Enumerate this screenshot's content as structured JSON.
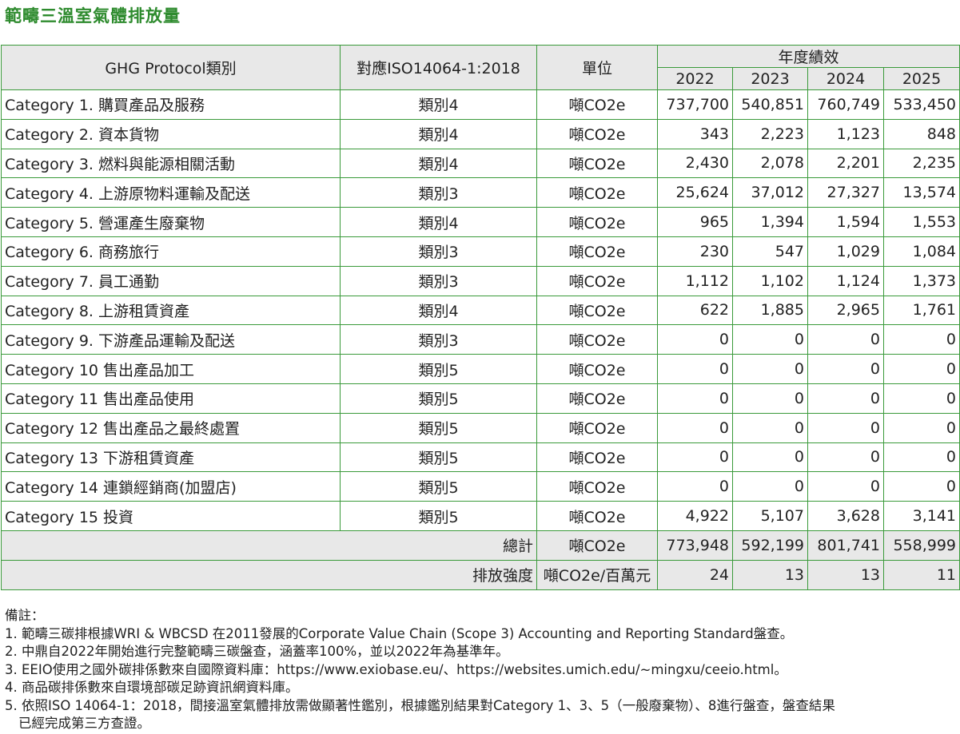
{
  "title": "範疇三溫室氣體排放量",
  "header": {
    "col_category": "GHG Protocol類別",
    "col_iso": "對應ISO14064-1:2018",
    "col_unit": "單位",
    "col_perf": "年度績效",
    "years": [
      "2022",
      "2023",
      "2024",
      "2025"
    ]
  },
  "rows": [
    {
      "category": "Category 1. 購買產品及服務",
      "iso": "類別4",
      "unit": "噸CO2e",
      "v": [
        "737,700",
        "540,851",
        "760,749",
        "533,450"
      ]
    },
    {
      "category": "Category 2. 資本貨物",
      "iso": "類別4",
      "unit": "噸CO2e",
      "v": [
        "343",
        "2,223",
        "1,123",
        "848"
      ]
    },
    {
      "category": "Category 3. 燃料與能源相關活動",
      "iso": "類別4",
      "unit": "噸CO2e",
      "v": [
        "2,430",
        "2,078",
        "2,201",
        "2,235"
      ]
    },
    {
      "category": "Category 4. 上游原物料運輸及配送",
      "iso": "類別3",
      "unit": "噸CO2e",
      "v": [
        "25,624",
        "37,012",
        "27,327",
        "13,574"
      ]
    },
    {
      "category": "Category 5. 營運產生廢棄物",
      "iso": "類別4",
      "unit": "噸CO2e",
      "v": [
        "965",
        "1,394",
        "1,594",
        "1,553"
      ]
    },
    {
      "category": "Category 6. 商務旅行",
      "iso": "類別3",
      "unit": "噸CO2e",
      "v": [
        "230",
        "547",
        "1,029",
        "1,084"
      ]
    },
    {
      "category": "Category 7. 員工通勤",
      "iso": "類別3",
      "unit": "噸CO2e",
      "v": [
        "1,112",
        "1,102",
        "1,124",
        "1,373"
      ]
    },
    {
      "category": "Category 8. 上游租賃資產",
      "iso": "類別4",
      "unit": "噸CO2e",
      "v": [
        "622",
        "1,885",
        "2,965",
        "1,761"
      ]
    },
    {
      "category": "Category 9. 下游產品運輸及配送",
      "iso": "類別3",
      "unit": "噸CO2e",
      "v": [
        "0",
        "0",
        "0",
        "0"
      ]
    },
    {
      "category": "Category 10 售出產品加工",
      "iso": "類別5",
      "unit": "噸CO2e",
      "v": [
        "0",
        "0",
        "0",
        "0"
      ]
    },
    {
      "category": "Category 11 售出產品使用",
      "iso": "類別5",
      "unit": "噸CO2e",
      "v": [
        "0",
        "0",
        "0",
        "0"
      ]
    },
    {
      "category": "Category 12 售出產品之最終處置",
      "iso": "類別5",
      "unit": "噸CO2e",
      "v": [
        "0",
        "0",
        "0",
        "0"
      ]
    },
    {
      "category": "Category 13 下游租賃資產",
      "iso": "類別5",
      "unit": "噸CO2e",
      "v": [
        "0",
        "0",
        "0",
        "0"
      ]
    },
    {
      "category": "Category 14 連鎖經銷商(加盟店)",
      "iso": "類別5",
      "unit": "噸CO2e",
      "v": [
        "0",
        "0",
        "0",
        "0"
      ]
    },
    {
      "category": "Category 15 投資",
      "iso": "類別5",
      "unit": "噸CO2e",
      "v": [
        "4,922",
        "5,107",
        "3,628",
        "3,141"
      ]
    }
  ],
  "total": {
    "label": "總計",
    "unit": "噸CO2e",
    "v": [
      "773,948",
      "592,199",
      "801,741",
      "558,999"
    ]
  },
  "intensity": {
    "label": "排放強度",
    "unit": "噸CO2e/百萬元",
    "v": [
      "24",
      "13",
      "13",
      "11"
    ]
  },
  "notes": [
    "備註：",
    "1. 範疇三碳排根據WRI & WBCSD 在2011發展的Corporate Value Chain (Scope 3) Accounting and Reporting Standard盤查。",
    "2. 中鼎自2022年開始進行完整範疇三碳盤查，涵蓋率100%，並以2022年為基準年。",
    "3. EEIO使用之國外碳排係數來自國際資料庫：https://www.exiobase.eu/、https://websites.umich.edu/~mingxu/ceeio.html。",
    "4. 商品碳排係數來自環境部碳足跡資訊網資料庫。",
    "5. 依照ISO 14064-1：2018，間接溫室氣體排放需做顯著性鑑別，根據鑑別結果對Category 1、3、5（一般廢棄物）、8進行盤查，盤查結果",
    "已經完成第三方查證。"
  ]
}
